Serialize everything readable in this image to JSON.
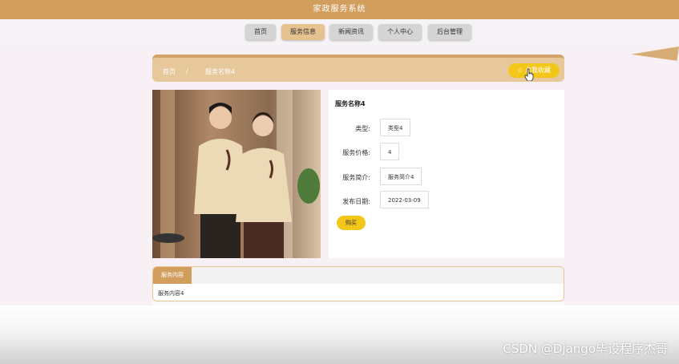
{
  "app_title": "家政服务系统",
  "nav": [
    {
      "label": "首页"
    },
    {
      "label": "服务信息"
    },
    {
      "label": "新闻资讯"
    },
    {
      "label": "个人中心"
    },
    {
      "label": "后台管理"
    }
  ],
  "breadcrumb": {
    "home": "首页",
    "separator": "/",
    "current": "服务名称4"
  },
  "collect_button": "点我收藏",
  "service": {
    "name": "服务名称4",
    "fields": [
      {
        "label": "类型:",
        "value": "类型4"
      },
      {
        "label": "服务价格:",
        "value": "4"
      },
      {
        "label": "服务简介:",
        "value": "服务简介4"
      },
      {
        "label": "发布日期:",
        "value": "2022-03-09"
      }
    ],
    "buy_label": "购买"
  },
  "content": {
    "tab": "服务内容",
    "text": "服务内容4"
  },
  "watermark": "CSDN @Django毕设程序杰哥",
  "colors": {
    "header": "#d19e5e",
    "accent_yellow": "#f3c71a",
    "active_nav": "#e7c291"
  }
}
